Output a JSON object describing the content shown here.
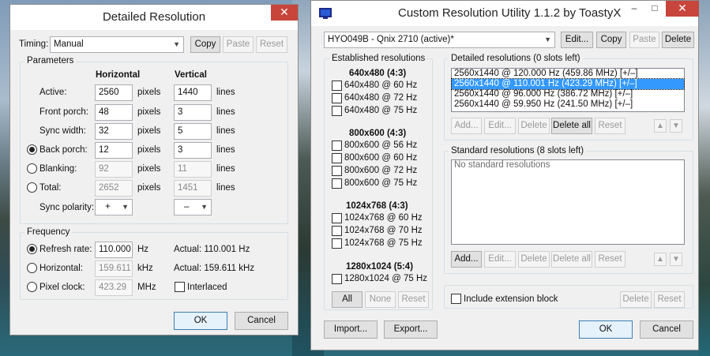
{
  "detailed_window": {
    "title": "Detailed Resolution",
    "close_label": "✕",
    "timing_label": "Timing:",
    "timing_value": "Manual",
    "copy_label": "Copy",
    "paste_label": "Paste",
    "reset_label": "Reset",
    "parameters_title": "Parameters",
    "col_horizontal": "Horizontal",
    "col_vertical": "Vertical",
    "rows": [
      {
        "label": "Active:",
        "h": "2560",
        "h_unit": "pixels",
        "v": "1440",
        "v_unit": "lines"
      },
      {
        "label": "Front porch:",
        "h": "48",
        "h_unit": "pixels",
        "v": "3",
        "v_unit": "lines"
      },
      {
        "label": "Sync width:",
        "h": "32",
        "h_unit": "pixels",
        "v": "5",
        "v_unit": "lines"
      },
      {
        "label": "Back porch:",
        "h": "12",
        "h_unit": "pixels",
        "v": "3",
        "v_unit": "lines"
      },
      {
        "label": "Blanking:",
        "h": "92",
        "h_unit": "pixels",
        "v": "11",
        "v_unit": "lines"
      },
      {
        "label": "Total:",
        "h": "2652",
        "h_unit": "pixels",
        "v": "1451",
        "v_unit": "lines"
      }
    ],
    "sync_polarity_label": "Sync polarity:",
    "sync_h": "+",
    "sync_v": "–",
    "frequency_title": "Frequency",
    "refresh_label": "Refresh rate:",
    "refresh_value": "110.000",
    "refresh_unit": "Hz",
    "refresh_actual": "Actual: 110.001 Hz",
    "horizontal_label": "Horizontal:",
    "horizontal_value": "159.611",
    "horizontal_unit": "kHz",
    "horizontal_actual": "Actual: 159.611 kHz",
    "pixelclock_label": "Pixel clock:",
    "pixelclock_value": "423.29",
    "pixelclock_unit": "MHz",
    "interlaced_label": "Interlaced",
    "ok_label": "OK",
    "cancel_label": "Cancel"
  },
  "cru_window": {
    "title": "Custom Resolution Utility 1.1.2 by ToastyX",
    "icon": "monitor-icon",
    "minimize_label": "–",
    "maximize_label": "□",
    "close_label": "✕",
    "monitor_value": "HYO049B - Qnix 2710 (active)*",
    "edit_label": "Edit...",
    "copy_label": "Copy",
    "paste_label": "Paste",
    "delete_label": "Delete",
    "established_title": "Established resolutions",
    "established_groups": [
      {
        "title": "640x480 (4:3)",
        "items": [
          "640x480 @ 60 Hz",
          "640x480 @ 72 Hz",
          "640x480 @ 75 Hz"
        ]
      },
      {
        "title": "800x600 (4:3)",
        "items": [
          "800x600 @ 56 Hz",
          "800x600 @ 60 Hz",
          "800x600 @ 72 Hz",
          "800x600 @ 75 Hz"
        ]
      },
      {
        "title": "1024x768 (4:3)",
        "items": [
          "1024x768 @ 60 Hz",
          "1024x768 @ 70 Hz",
          "1024x768 @ 75 Hz"
        ]
      },
      {
        "title": "1280x1024 (5:4)",
        "items": [
          "1280x1024 @ 75 Hz"
        ]
      }
    ],
    "est_all_label": "All",
    "est_none_label": "None",
    "est_reset_label": "Reset",
    "detailed_title": "Detailed resolutions (0 slots left)",
    "detailed_items": [
      "2560x1440 @ 120.000 Hz (459.86 MHz) [+/–]",
      "2560x1440 @ 110.001 Hz (423.29 MHz) [+/–]",
      "2560x1440 @ 96.000 Hz (386.72 MHz) [+/–]",
      "2560x1440 @ 59.950 Hz (241.50 MHz) [+/–]"
    ],
    "detailed_selected_index": 1,
    "add_label": "Add...",
    "edit2_label": "Edit...",
    "delete2_label": "Delete",
    "delete_all_label": "Delete all",
    "reset2_label": "Reset",
    "up_label": "▲",
    "down_label": "▼",
    "standard_title": "Standard resolutions (8 slots left)",
    "standard_empty": "No standard resolutions",
    "extension_label": "Include extension block",
    "ext_delete_label": "Delete",
    "ext_reset_label": "Reset",
    "import_label": "Import...",
    "export_label": "Export...",
    "ok_label": "OK",
    "cancel_label": "Cancel"
  }
}
